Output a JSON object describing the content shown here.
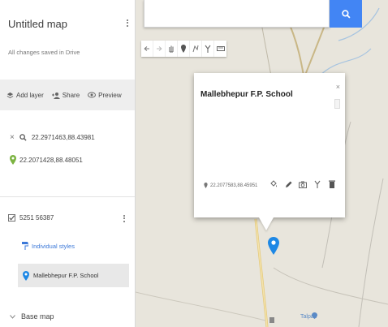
{
  "panel": {
    "title": "Untitled map",
    "saved_status": "All changes saved in Drive",
    "actions": {
      "add_layer": "Add layer",
      "share": "Share",
      "preview": "Preview"
    },
    "search": {
      "query": "22.2971463,88.43981",
      "close": "×"
    },
    "result": {
      "label": "22.2071428,88.48051"
    },
    "layer": {
      "name": "5251 56387",
      "style_label": "Individual styles",
      "place_name": "Mallebhepur F.P. School"
    },
    "basemap": {
      "label": "Base map"
    }
  },
  "map": {
    "search_value": "",
    "card": {
      "title": "Mallebhepur F.P. School",
      "close": "×",
      "coords": "22.2077583,88.45951"
    },
    "poi_label": "Talpati"
  },
  "colors": {
    "accent": "#4285f4",
    "marker": "#1e88e5",
    "result_pin": "#7cb342",
    "link": "#3b78d8"
  }
}
